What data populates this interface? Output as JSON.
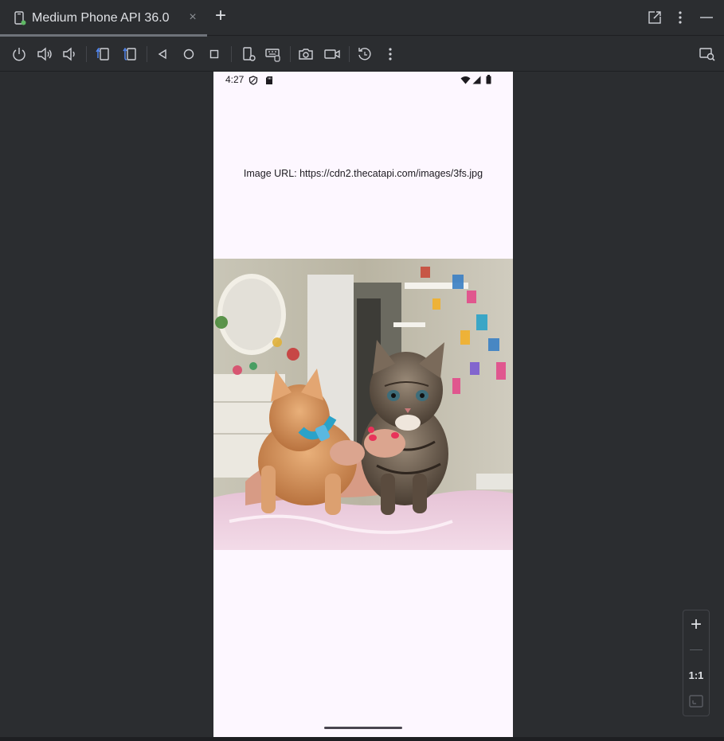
{
  "tab": {
    "title": "Medium Phone API 36.0",
    "close_glyph": "×",
    "new_tab_glyph": "+",
    "icon": "device-phone-icon"
  },
  "window_actions": [
    "open-in-window-icon",
    "more-vertical-icon",
    "minimize-icon"
  ],
  "toolbar": {
    "buttons": [
      "power-icon",
      "volume-up-icon",
      "volume-down-icon",
      "rotate-left-icon",
      "rotate-right-icon",
      "back-icon",
      "home-icon",
      "overview-icon",
      "device-settings-icon",
      "keyboard-icon",
      "screenshot-icon",
      "screen-record-icon",
      "snapshot-restore-icon",
      "more-vertical-icon"
    ],
    "right_button": "device-mirroring-icon"
  },
  "device": {
    "status_bar": {
      "time": "4:27",
      "left_icons": [
        "vpn-shield-icon",
        "sd-card-icon"
      ],
      "right_icons": [
        "wifi-icon",
        "signal-icon",
        "battery-icon"
      ]
    },
    "url_label": "Image URL: https://cdn2.thecatapi.com/images/3fs.jpg",
    "photo": "two-kittens-photo"
  },
  "zoom_controls": {
    "plus": "+",
    "ratio": "1:1"
  },
  "colors": {
    "ide_background": "#2b2d30",
    "device_background": "#fdf7ff",
    "text_primary": "#dfe1e5"
  }
}
